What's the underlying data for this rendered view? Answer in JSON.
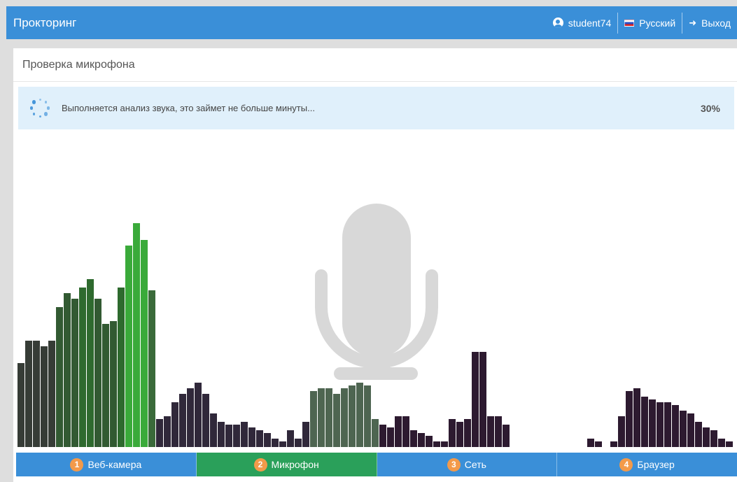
{
  "navbar": {
    "brand": "Прокторинг",
    "user": "student74",
    "language": "Русский",
    "logout": "Выход"
  },
  "panel": {
    "title": "Проверка микрофона"
  },
  "alert": {
    "text": "Выполняется анализ звука, это займет не больше минуты...",
    "percent": "30%"
  },
  "visualizer": {
    "icon": "microphone-icon",
    "levels": [
      0.3,
      0.38,
      0.38,
      0.36,
      0.38,
      0.5,
      0.55,
      0.53,
      0.57,
      0.6,
      0.53,
      0.44,
      0.45,
      0.57,
      0.72,
      0.8,
      0.74,
      0.56,
      0.1,
      0.11,
      0.16,
      0.19,
      0.21,
      0.23,
      0.19,
      0.12,
      0.09,
      0.08,
      0.08,
      0.09,
      0.07,
      0.06,
      0.05,
      0.03,
      0.02,
      0.06,
      0.03,
      0.09,
      0.2,
      0.21,
      0.21,
      0.19,
      0.21,
      0.22,
      0.23,
      0.22,
      0.1,
      0.08,
      0.07,
      0.11,
      0.11,
      0.06,
      0.05,
      0.04,
      0.02,
      0.02,
      0.1,
      0.09,
      0.1,
      0.34,
      0.34,
      0.11,
      0.11,
      0.08,
      0,
      0,
      0,
      0,
      0,
      0,
      0,
      0,
      0,
      0,
      0.03,
      0.02,
      0,
      0.02,
      0.11,
      0.2,
      0.21,
      0.18,
      0.17,
      0.16,
      0.16,
      0.15,
      0.13,
      0.12,
      0.09,
      0.07,
      0.06,
      0.03,
      0.02
    ],
    "color_stops": [
      "#3a3a3a",
      "#2b5e2b",
      "#2d8f2d",
      "#3dbb3d",
      "#2a1a2e"
    ]
  },
  "steps": [
    {
      "num": "1",
      "label": "Веб-камера",
      "color": "#3a8fd8"
    },
    {
      "num": "2",
      "label": "Микрофон",
      "color": "#2aa05a"
    },
    {
      "num": "3",
      "label": "Сеть",
      "color": "#3a8fd8"
    },
    {
      "num": "4",
      "label": "Браузер",
      "color": "#3a8fd8"
    }
  ]
}
